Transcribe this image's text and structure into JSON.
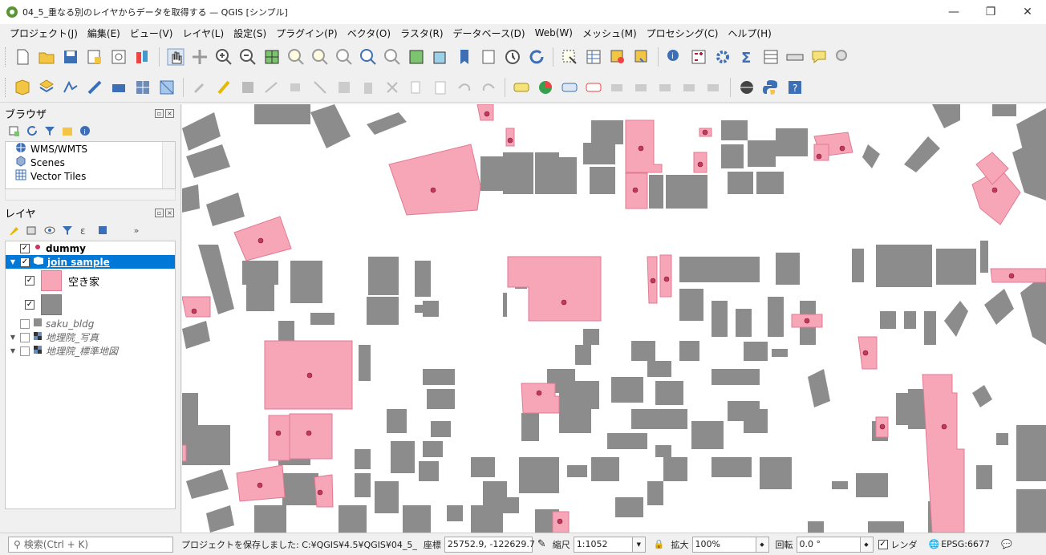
{
  "window": {
    "title": "04_5_重なる別のレイヤからデータを取得する — QGIS [シンプル]",
    "controls": [
      "—",
      "❐",
      "✕"
    ]
  },
  "menu": [
    "プロジェクト(J)",
    "編集(E)",
    "ビュー(V)",
    "レイヤ(L)",
    "設定(S)",
    "プラグイン(P)",
    "ベクタ(O)",
    "ラスタ(R)",
    "データベース(D)",
    "Web(W)",
    "メッシュ(M)",
    "プロセシング(C)",
    "ヘルプ(H)"
  ],
  "browser": {
    "title": "ブラウザ",
    "items": [
      "WMS/WMTS",
      "Scenes",
      "Vector Tiles"
    ]
  },
  "layers": {
    "title": "レイヤ",
    "items": [
      {
        "name": "dummy",
        "checked": "✓"
      },
      {
        "name": "join sample",
        "checked": "✓"
      },
      {
        "legend": "空き家",
        "checked": "✓"
      },
      {
        "legend": "",
        "checked": "✓"
      },
      {
        "name": "saku_bldg",
        "checked": ""
      },
      {
        "name": "地理院_写真",
        "checked": ""
      },
      {
        "name": "地理院_標準地図",
        "checked": ""
      }
    ]
  },
  "status": {
    "search_placeholder": "検索(Ctrl + K)",
    "message": "プロジェクトを保存しました: C:¥QGIS¥4.5¥QGIS¥04_5_",
    "coord_label": "座標",
    "coord_value": "25752.9, -122629.7",
    "scale_label": "縮尺",
    "scale_value": "1:1052",
    "magnifier_label": "拡大",
    "magnifier_value": "100%",
    "rotation_label": "回転",
    "rotation_value": "0.0 °",
    "render_label": "レンダ",
    "crs": "EPSG:6677"
  },
  "colors": {
    "building": "#8c8c8c",
    "vacant_fill": "#f7a6b8",
    "vacant_stroke": "#e07a93",
    "dot": "#c6375e",
    "selection": "#0078d7"
  }
}
